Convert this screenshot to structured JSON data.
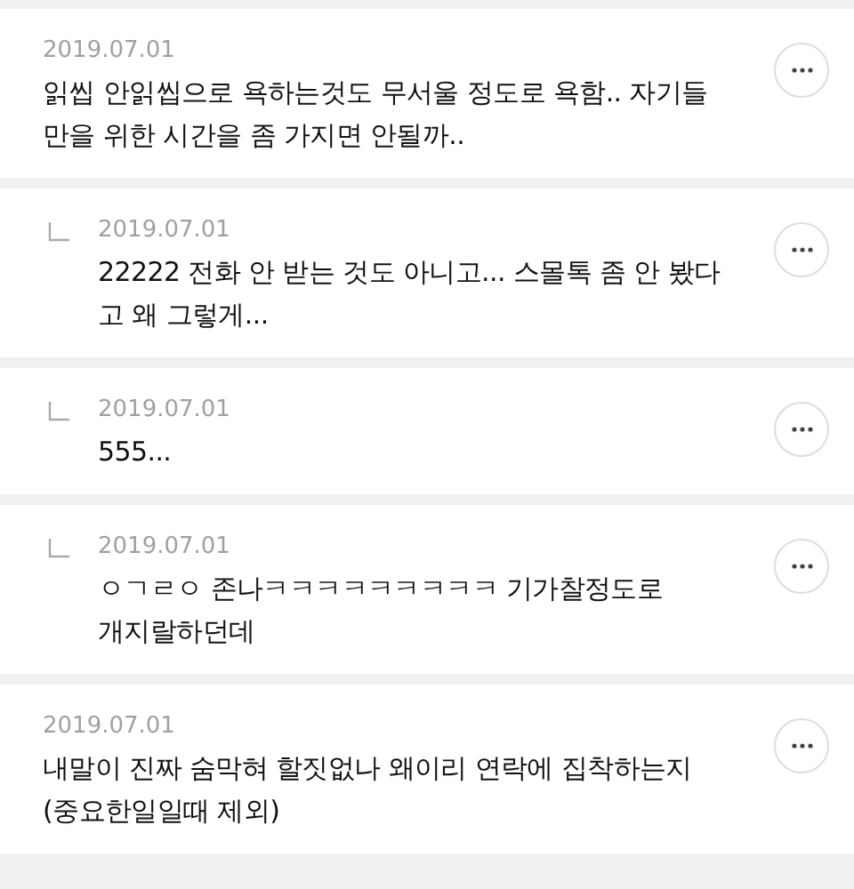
{
  "comments": [
    {
      "kind": "comment",
      "date": "2019.07.01",
      "text": "읽씹 안읽씹으로 욕하는것도 무서울 정도로 욕함.. 자기들\n만을 위한 시간을 좀 가지면 안될까.."
    },
    {
      "kind": "reply",
      "date": "2019.07.01",
      "text": "22222 전화 안 받는 것도 아니고... 스몰톡 좀 안 봤다\n고 왜 그렇게..."
    },
    {
      "kind": "reply",
      "date": "2019.07.01",
      "text": "555..."
    },
    {
      "kind": "reply",
      "date": "2019.07.01",
      "text": "ㅇㄱㄹㅇ 존나ㅋㅋㅋㅋㅋㅋㅋㅋㅋ 기가찰정도로\n개지랄하던데"
    },
    {
      "kind": "comment",
      "date": "2019.07.01",
      "text": "내말이 진짜 숨막혀 할짓없나 왜이리 연락에 집착하는지\n(중요한일일때 제외)"
    }
  ]
}
